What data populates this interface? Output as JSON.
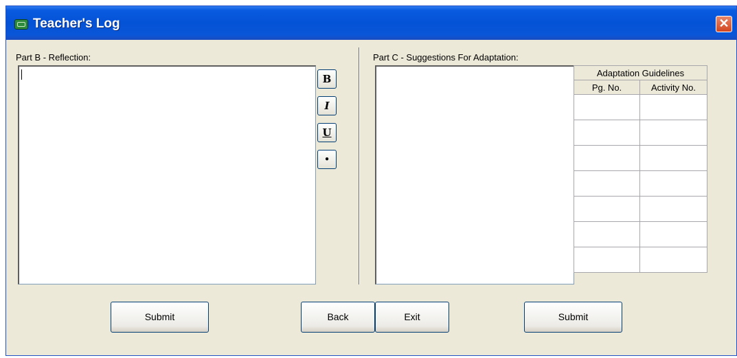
{
  "window": {
    "title": "Teacher's Log",
    "close_glyph": "✕"
  },
  "part_b": {
    "label": "Part B - Reflection:",
    "text": "",
    "format_buttons": [
      {
        "name": "bold",
        "glyph": "B"
      },
      {
        "name": "italic",
        "glyph": "I"
      },
      {
        "name": "underline",
        "glyph": "U"
      },
      {
        "name": "bullet",
        "glyph": "•"
      }
    ]
  },
  "part_c": {
    "label": "Part C - Suggestions For Adaptation:",
    "text": "",
    "guidelines": {
      "title": "Adaptation Guidelines",
      "columns": [
        "Pg. No.",
        "Activity No."
      ],
      "rows": [
        [
          "",
          ""
        ],
        [
          "",
          ""
        ],
        [
          "",
          ""
        ],
        [
          "",
          ""
        ],
        [
          "",
          ""
        ],
        [
          "",
          ""
        ],
        [
          "",
          ""
        ]
      ]
    }
  },
  "buttons": {
    "submit_left": "Submit",
    "back": "Back",
    "exit": "Exit",
    "submit_right": "Submit"
  },
  "colors": {
    "title_bar": "#0452d6",
    "window_bg": "#ece9d8",
    "close": "#d3461f"
  }
}
